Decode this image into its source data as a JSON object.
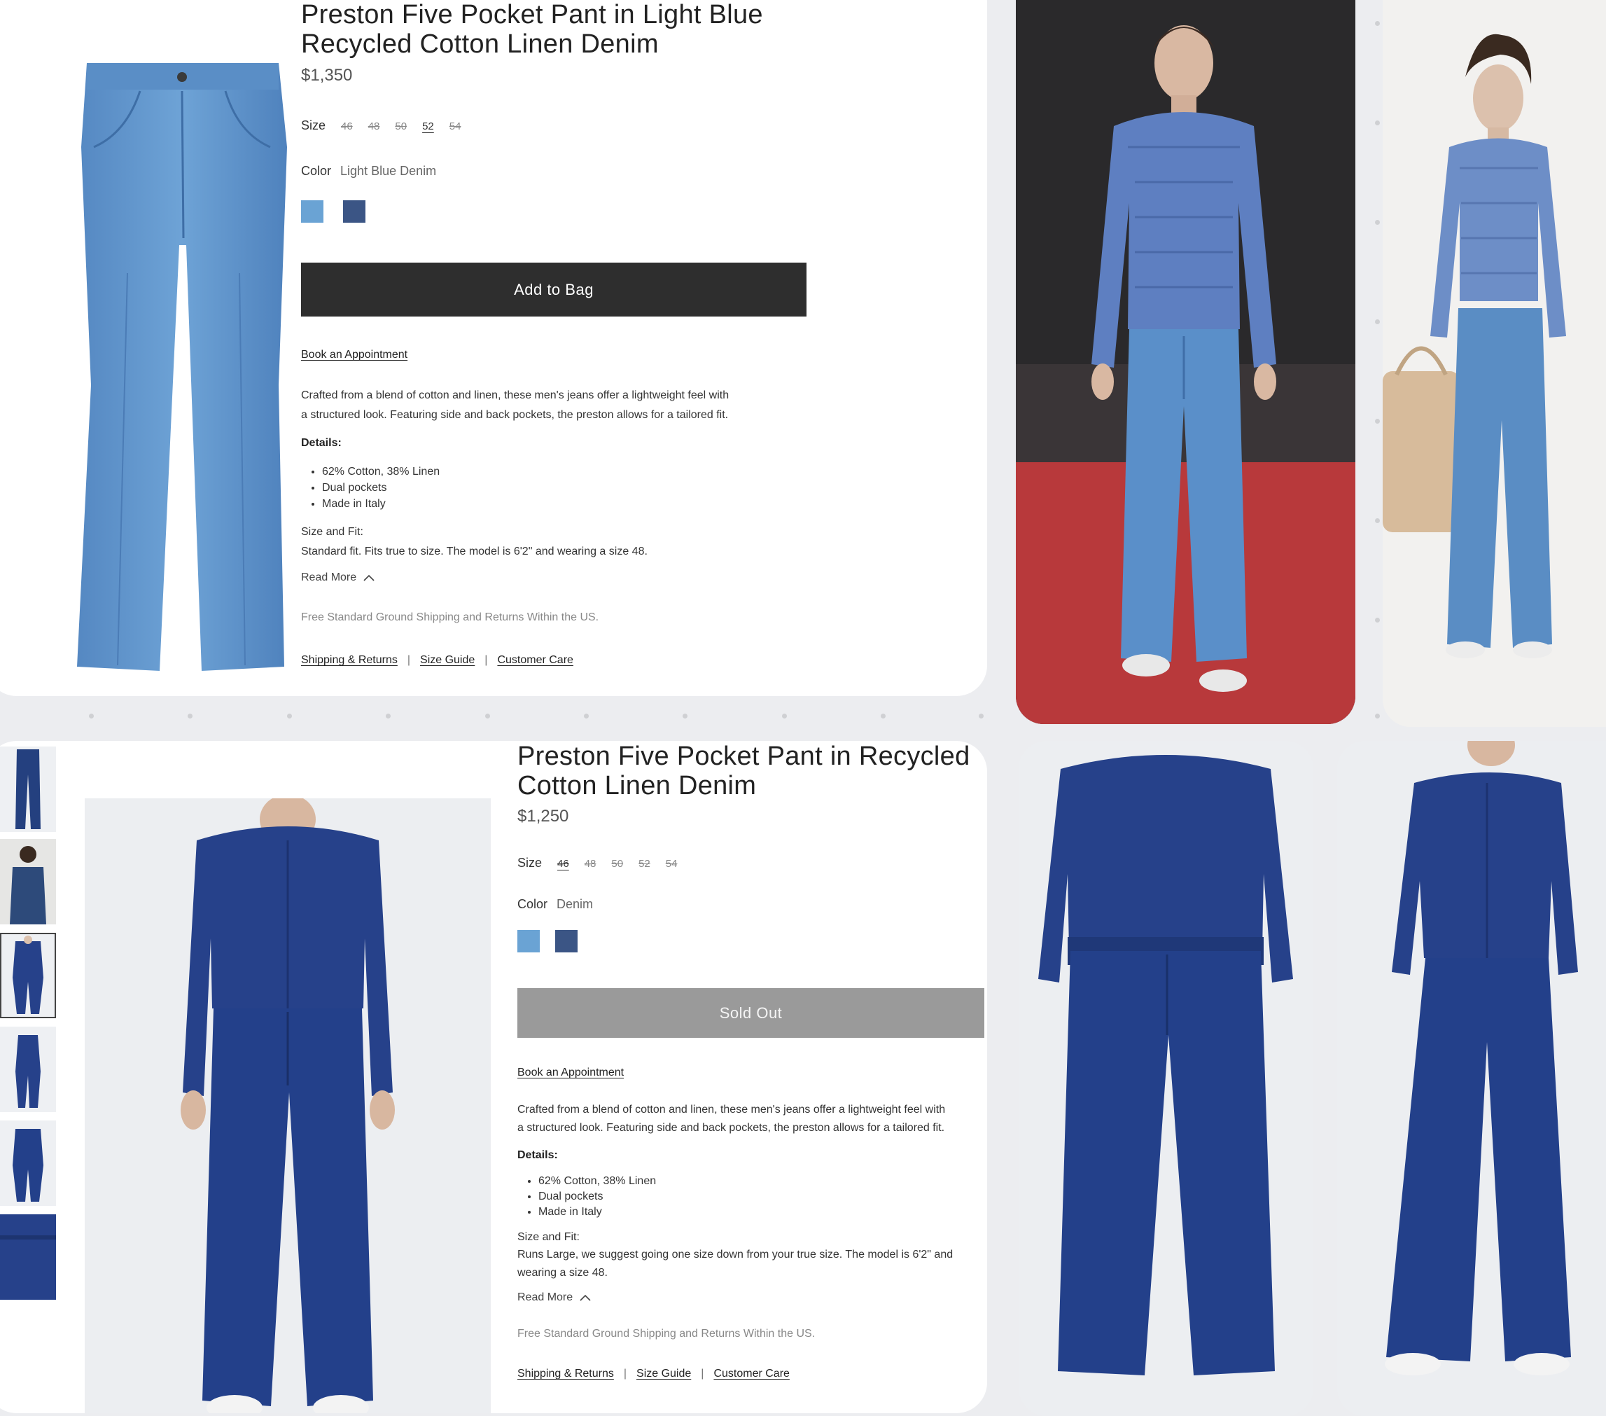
{
  "product1": {
    "title_line1": "Preston Five Pocket Pant in Light Blue",
    "title_line2": "Recycled Cotton Linen Denim",
    "price": "$1,350",
    "size_label": "Size",
    "sizes": [
      "46",
      "48",
      "50",
      "52",
      "54"
    ],
    "color_label": "Color",
    "color_value": "Light Blue Denim",
    "swatch_colors": [
      "#6aa3d4",
      "#3b5585"
    ],
    "button_label": "Add to Bag",
    "appointment_label": "Book an Appointment",
    "description_line1": "Crafted from a blend of cotton and linen, these men's jeans offer a lightweight feel with",
    "description_line2": "a structured look. Featuring side and back pockets, the preston allows for a tailored fit.",
    "details_heading": "Details:",
    "details": [
      "62% Cotton, 38% Linen",
      "Dual pockets",
      "Made in Italy"
    ],
    "fit_heading": "Size and Fit:",
    "fit_text": "Standard fit. Fits true to size. The model is 6'2\" and wearing a size 48.",
    "read_more": "Read More",
    "shipping_note": "Free Standard Ground Shipping and Returns Within the US.",
    "footer_links": [
      "Shipping & Returns",
      "Size Guide",
      "Customer Care"
    ]
  },
  "product2": {
    "title_line1": "Preston Five Pocket Pant in Recycled",
    "title_line2": "Cotton Linen Denim",
    "price": "$1,250",
    "size_label": "Size",
    "sizes": [
      "46",
      "48",
      "50",
      "52",
      "54"
    ],
    "color_label": "Color",
    "color_value": "Denim",
    "swatch_colors": [
      "#6aa3d4",
      "#3b5585"
    ],
    "button_label": "Sold Out",
    "appointment_label": "Book an Appointment",
    "description_line1": "Crafted from a blend of cotton and linen, these men's jeans offer a lightweight feel with",
    "description_line2": "a structured look. Featuring side and back pockets, the preston allows for a tailored fit.",
    "details_heading": "Details:",
    "details": [
      "62% Cotton, 38% Linen",
      "Dual pockets",
      "Made in Italy"
    ],
    "fit_heading": "Size and Fit:",
    "fit_text_line1": "Runs Large, we suggest going one size down from your true size. The model is 6'2\" and",
    "fit_text_line2": "wearing a size 48.",
    "read_more": "Read More",
    "shipping_note": "Free Standard Ground Shipping and Returns Within the US.",
    "footer_links": [
      "Shipping & Returns",
      "Size Guide",
      "Customer Care"
    ]
  },
  "colors": {
    "light_denim": "#5f95cb",
    "dark_denim": "#26418a",
    "add_button": "#2e2e2e",
    "sold_out_button": "#9a9a9a",
    "runway_floor": "#b8393b"
  }
}
